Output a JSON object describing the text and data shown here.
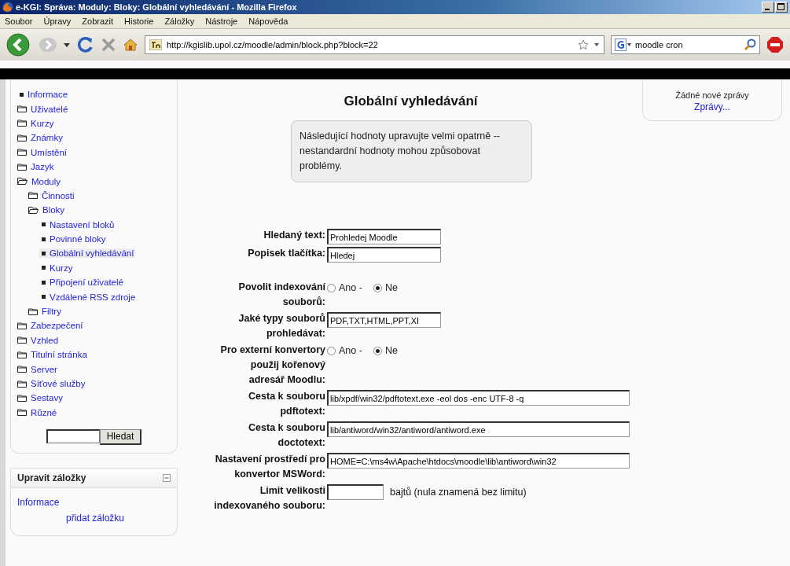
{
  "window": {
    "title": "e-KGI: Správa: Moduly: Bloky: Globální vyhledávání - Mozilla Firefox"
  },
  "menu": [
    "Soubor",
    "Úpravy",
    "Zobrazit",
    "Historie",
    "Záložky",
    "Nástroje",
    "Nápověda"
  ],
  "nav": {
    "url": "http://kgislib.upol.cz/moodle/admin/block.php?block=22",
    "search": "moodle cron"
  },
  "admin_block": {
    "tree": [
      {
        "kind": "page",
        "label": "Informace",
        "selected": false
      },
      {
        "kind": "folder",
        "label": "Uživatelé",
        "expanded": false
      },
      {
        "kind": "folder",
        "label": "Kurzy",
        "expanded": false
      },
      {
        "kind": "folder",
        "label": "Známky",
        "expanded": false
      },
      {
        "kind": "folder",
        "label": "Umístění",
        "expanded": false
      },
      {
        "kind": "folder",
        "label": "Jazyk",
        "expanded": false
      },
      {
        "kind": "folder",
        "label": "Moduly",
        "expanded": true,
        "children": [
          {
            "kind": "folder",
            "label": "Činnosti",
            "expanded": false
          },
          {
            "kind": "folder",
            "label": "Bloky",
            "expanded": true,
            "children": [
              {
                "kind": "page",
                "label": "Nastavení bloků",
                "selected": false
              },
              {
                "kind": "page",
                "label": "Povinné bloky",
                "selected": false
              },
              {
                "kind": "page",
                "label": "Globální vyhledávání",
                "selected": true
              },
              {
                "kind": "page",
                "label": "Kurzy",
                "selected": false
              },
              {
                "kind": "page",
                "label": "Připojení uživatelé",
                "selected": false
              },
              {
                "kind": "page",
                "label": "Vzdálené RSS zdroje",
                "selected": false
              }
            ]
          },
          {
            "kind": "folder",
            "label": "Filtry",
            "expanded": false
          }
        ]
      },
      {
        "kind": "folder",
        "label": "Zabezpečení",
        "expanded": false
      },
      {
        "kind": "folder",
        "label": "Vzhled",
        "expanded": false
      },
      {
        "kind": "folder",
        "label": "Titulní stránka",
        "expanded": false
      },
      {
        "kind": "folder",
        "label": "Server",
        "expanded": false
      },
      {
        "kind": "folder",
        "label": "Síťové služby",
        "expanded": false
      },
      {
        "kind": "folder",
        "label": "Sestavy",
        "expanded": false
      },
      {
        "kind": "folder",
        "label": "Různé",
        "expanded": false
      }
    ],
    "search_button": "Hledat"
  },
  "bookmarks_block": {
    "title": "Upravit záložky",
    "link": "Informace",
    "add": "přidat záložku"
  },
  "main": {
    "heading": "Globální vyhledávání",
    "notice": "Následující hodnoty upravujte velmi opatrně -- nestandardní hodnoty mohou způsobovat problémy.",
    "fields": [
      {
        "kind": "text",
        "label": "Hledaný text:",
        "value": "Prohledej Moodle"
      },
      {
        "kind": "text",
        "label": "Popisek tlačítka:",
        "value": "Hledej"
      },
      {
        "kind": "radio",
        "label": "Povolit indexování souborů:",
        "options": [
          {
            "label": "Ano -",
            "selected": false
          },
          {
            "label": "Ne",
            "selected": true
          }
        ]
      },
      {
        "kind": "text",
        "label": "Jaké typy souborů prohledávat:",
        "value": "PDF,TXT,HTML,PPT,XI"
      },
      {
        "kind": "radio",
        "label": "Pro externí konvertory použij kořenový adresář Moodlu:",
        "options": [
          {
            "label": "Ano -",
            "selected": false
          },
          {
            "label": "Ne",
            "selected": true
          }
        ]
      },
      {
        "kind": "path",
        "label": "Cesta k souboru pdftotext:",
        "value": "lib/xpdf/win32/pdftotext.exe -eol dos -enc UTF-8 -q"
      },
      {
        "kind": "path",
        "label": "Cesta k souboru doctotext:",
        "value": "lib/antiword/win32/antiword/antiword.exe"
      },
      {
        "kind": "path",
        "label": "Nastavení prostředí pro konvertor MSWord:",
        "value": "HOME=C:\\ms4w\\Apache\\htdocs\\moodle\\lib\\antiword\\win32"
      },
      {
        "kind": "number",
        "label": "Limit velikosti indexovaného souboru:",
        "suffix": "bajtů (nula znamená bez limitu)"
      }
    ]
  },
  "messages_block": {
    "text": "Žádné nové zprávy",
    "link": "Zprávy..."
  }
}
